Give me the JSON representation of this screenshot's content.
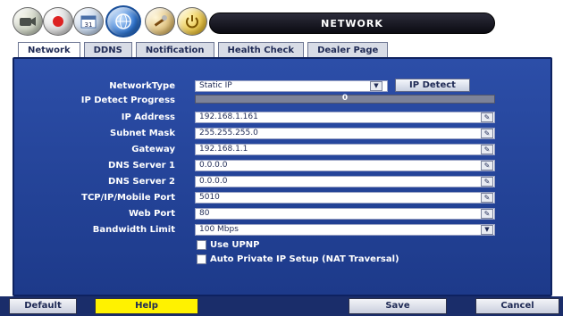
{
  "header": {
    "title": "NETWORK",
    "icons": [
      "camera-icon",
      "record-icon",
      "calendar-icon",
      "network-icon",
      "tools-icon",
      "power-icon"
    ],
    "calendar_text": "31"
  },
  "tabs": [
    {
      "label": "Network",
      "active": true
    },
    {
      "label": "DDNS",
      "active": false
    },
    {
      "label": "Notification",
      "active": false
    },
    {
      "label": "Health Check",
      "active": false
    },
    {
      "label": "Dealer Page",
      "active": false
    }
  ],
  "form": {
    "network_type": {
      "label": "NetworkType",
      "value": "Static IP"
    },
    "ip_detect_button": "IP Detect",
    "ip_detect_progress": {
      "label": "IP Detect Progress",
      "value": 0,
      "text": "0"
    },
    "ip_address": {
      "label": "IP Address",
      "value": "192.168.1.161"
    },
    "subnet_mask": {
      "label": "Subnet Mask",
      "value": "255.255.255.0"
    },
    "gateway": {
      "label": "Gateway",
      "value": "192.168.1.1"
    },
    "dns1": {
      "label": "DNS Server 1",
      "value": "0.0.0.0"
    },
    "dns2": {
      "label": "DNS Server 2",
      "value": "0.0.0.0"
    },
    "tcp_port": {
      "label": "TCP/IP/Mobile Port",
      "value": "5010"
    },
    "web_port": {
      "label": "Web Port",
      "value": "80"
    },
    "bandwidth": {
      "label": "Bandwidth Limit",
      "value": "100 Mbps"
    },
    "use_upnp": {
      "label": "Use UPNP",
      "checked": false
    },
    "auto_private_ip": {
      "label": "Auto Private IP Setup (NAT Traversal)",
      "checked": false
    }
  },
  "buttons": {
    "default": "Default",
    "help": "Help",
    "save": "Save",
    "cancel": "Cancel"
  },
  "colors": {
    "panel": "#1d3a8a",
    "help_button": "#fff200",
    "title_bar": "#0b0b12"
  }
}
